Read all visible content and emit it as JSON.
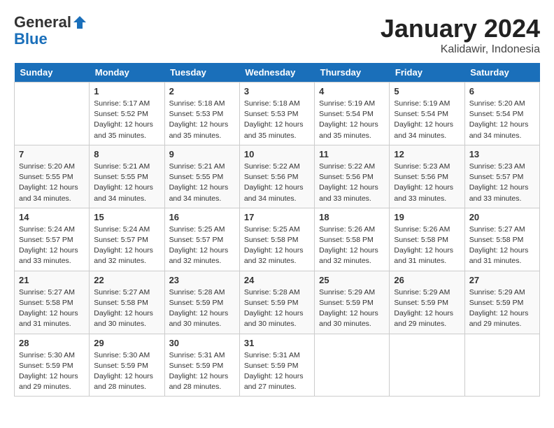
{
  "header": {
    "logo_general": "General",
    "logo_blue": "Blue",
    "month_year": "January 2024",
    "location": "Kalidawir, Indonesia"
  },
  "days_of_week": [
    "Sunday",
    "Monday",
    "Tuesday",
    "Wednesday",
    "Thursday",
    "Friday",
    "Saturday"
  ],
  "weeks": [
    [
      {
        "day": "",
        "info": ""
      },
      {
        "day": "1",
        "info": "Sunrise: 5:17 AM\nSunset: 5:52 PM\nDaylight: 12 hours\nand 35 minutes."
      },
      {
        "day": "2",
        "info": "Sunrise: 5:18 AM\nSunset: 5:53 PM\nDaylight: 12 hours\nand 35 minutes."
      },
      {
        "day": "3",
        "info": "Sunrise: 5:18 AM\nSunset: 5:53 PM\nDaylight: 12 hours\nand 35 minutes."
      },
      {
        "day": "4",
        "info": "Sunrise: 5:19 AM\nSunset: 5:54 PM\nDaylight: 12 hours\nand 35 minutes."
      },
      {
        "day": "5",
        "info": "Sunrise: 5:19 AM\nSunset: 5:54 PM\nDaylight: 12 hours\nand 34 minutes."
      },
      {
        "day": "6",
        "info": "Sunrise: 5:20 AM\nSunset: 5:54 PM\nDaylight: 12 hours\nand 34 minutes."
      }
    ],
    [
      {
        "day": "7",
        "info": "Sunrise: 5:20 AM\nSunset: 5:55 PM\nDaylight: 12 hours\nand 34 minutes."
      },
      {
        "day": "8",
        "info": "Sunrise: 5:21 AM\nSunset: 5:55 PM\nDaylight: 12 hours\nand 34 minutes."
      },
      {
        "day": "9",
        "info": "Sunrise: 5:21 AM\nSunset: 5:55 PM\nDaylight: 12 hours\nand 34 minutes."
      },
      {
        "day": "10",
        "info": "Sunrise: 5:22 AM\nSunset: 5:56 PM\nDaylight: 12 hours\nand 34 minutes."
      },
      {
        "day": "11",
        "info": "Sunrise: 5:22 AM\nSunset: 5:56 PM\nDaylight: 12 hours\nand 33 minutes."
      },
      {
        "day": "12",
        "info": "Sunrise: 5:23 AM\nSunset: 5:56 PM\nDaylight: 12 hours\nand 33 minutes."
      },
      {
        "day": "13",
        "info": "Sunrise: 5:23 AM\nSunset: 5:57 PM\nDaylight: 12 hours\nand 33 minutes."
      }
    ],
    [
      {
        "day": "14",
        "info": "Sunrise: 5:24 AM\nSunset: 5:57 PM\nDaylight: 12 hours\nand 33 minutes."
      },
      {
        "day": "15",
        "info": "Sunrise: 5:24 AM\nSunset: 5:57 PM\nDaylight: 12 hours\nand 32 minutes."
      },
      {
        "day": "16",
        "info": "Sunrise: 5:25 AM\nSunset: 5:57 PM\nDaylight: 12 hours\nand 32 minutes."
      },
      {
        "day": "17",
        "info": "Sunrise: 5:25 AM\nSunset: 5:58 PM\nDaylight: 12 hours\nand 32 minutes."
      },
      {
        "day": "18",
        "info": "Sunrise: 5:26 AM\nSunset: 5:58 PM\nDaylight: 12 hours\nand 32 minutes."
      },
      {
        "day": "19",
        "info": "Sunrise: 5:26 AM\nSunset: 5:58 PM\nDaylight: 12 hours\nand 31 minutes."
      },
      {
        "day": "20",
        "info": "Sunrise: 5:27 AM\nSunset: 5:58 PM\nDaylight: 12 hours\nand 31 minutes."
      }
    ],
    [
      {
        "day": "21",
        "info": "Sunrise: 5:27 AM\nSunset: 5:58 PM\nDaylight: 12 hours\nand 31 minutes."
      },
      {
        "day": "22",
        "info": "Sunrise: 5:27 AM\nSunset: 5:58 PM\nDaylight: 12 hours\nand 30 minutes."
      },
      {
        "day": "23",
        "info": "Sunrise: 5:28 AM\nSunset: 5:59 PM\nDaylight: 12 hours\nand 30 minutes."
      },
      {
        "day": "24",
        "info": "Sunrise: 5:28 AM\nSunset: 5:59 PM\nDaylight: 12 hours\nand 30 minutes."
      },
      {
        "day": "25",
        "info": "Sunrise: 5:29 AM\nSunset: 5:59 PM\nDaylight: 12 hours\nand 30 minutes."
      },
      {
        "day": "26",
        "info": "Sunrise: 5:29 AM\nSunset: 5:59 PM\nDaylight: 12 hours\nand 29 minutes."
      },
      {
        "day": "27",
        "info": "Sunrise: 5:29 AM\nSunset: 5:59 PM\nDaylight: 12 hours\nand 29 minutes."
      }
    ],
    [
      {
        "day": "28",
        "info": "Sunrise: 5:30 AM\nSunset: 5:59 PM\nDaylight: 12 hours\nand 29 minutes."
      },
      {
        "day": "29",
        "info": "Sunrise: 5:30 AM\nSunset: 5:59 PM\nDaylight: 12 hours\nand 28 minutes."
      },
      {
        "day": "30",
        "info": "Sunrise: 5:31 AM\nSunset: 5:59 PM\nDaylight: 12 hours\nand 28 minutes."
      },
      {
        "day": "31",
        "info": "Sunrise: 5:31 AM\nSunset: 5:59 PM\nDaylight: 12 hours\nand 27 minutes."
      },
      {
        "day": "",
        "info": ""
      },
      {
        "day": "",
        "info": ""
      },
      {
        "day": "",
        "info": ""
      }
    ]
  ]
}
